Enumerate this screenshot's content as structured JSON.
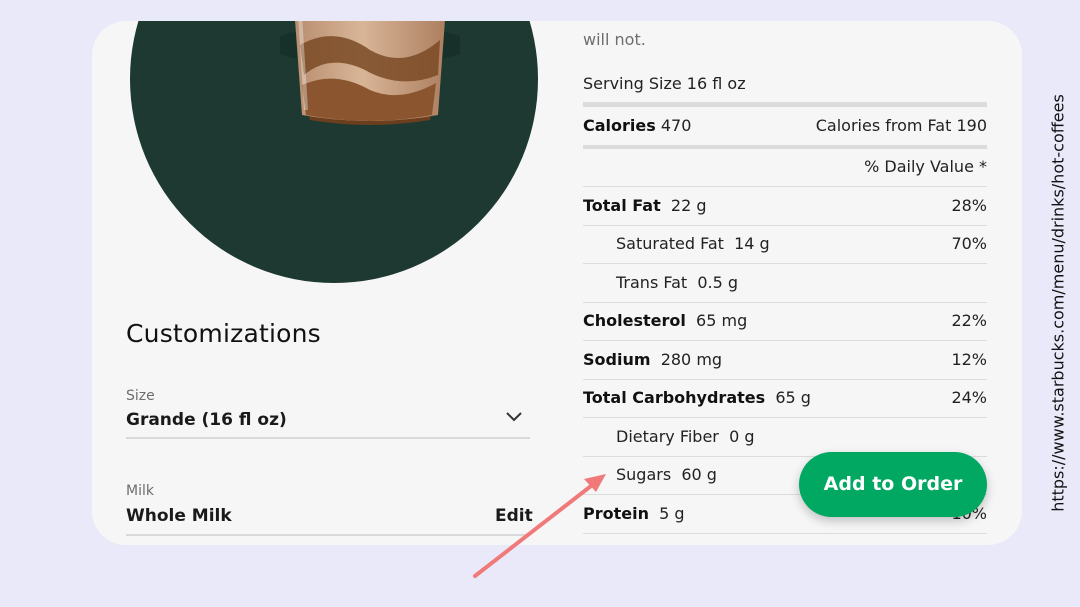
{
  "customizations": {
    "title": "Customizations",
    "size": {
      "label": "Size",
      "value": "Grande (16 fl oz)",
      "icon": "chevron-down-icon"
    },
    "milk": {
      "label": "Milk",
      "value": "Whole Milk",
      "edit_label": "Edit"
    }
  },
  "nutrition": {
    "intro_text": "will not.",
    "serving_size": "Serving Size 16 fl oz",
    "calories_label": "Calories",
    "calories_value": "470",
    "calories_from_fat": "Calories from Fat 190",
    "daily_value_header": "% Daily Value *",
    "rows": [
      {
        "name": "Total Fat",
        "amount": "22 g",
        "dv": "28%",
        "bold": true
      },
      {
        "name": "Saturated Fat",
        "amount": "14 g",
        "dv": "70%",
        "bold": false
      },
      {
        "name": "Trans Fat",
        "amount": "0.5 g",
        "dv": "",
        "bold": false
      },
      {
        "name": "Cholesterol",
        "amount": "65 mg",
        "dv": "22%",
        "bold": true
      },
      {
        "name": "Sodium",
        "amount": "280 mg",
        "dv": "12%",
        "bold": true
      },
      {
        "name": "Total Carbohydrates",
        "amount": "65 g",
        "dv": "24%",
        "bold": true
      },
      {
        "name": "Dietary Fiber",
        "amount": "0 g",
        "dv": "",
        "bold": false
      },
      {
        "name": "Sugars",
        "amount": "60 g",
        "dv": "",
        "bold": false
      },
      {
        "name": "Protein",
        "amount": "5 g",
        "dv": "10%",
        "bold": true
      }
    ]
  },
  "add_to_order_label": "Add to Order",
  "url_text": "https://www.starbucks.com/menu/drinks/hot-coffees",
  "colors": {
    "brand_green": "#00a862",
    "house_green": "#1e3932",
    "arrow": "#f07a7a"
  }
}
